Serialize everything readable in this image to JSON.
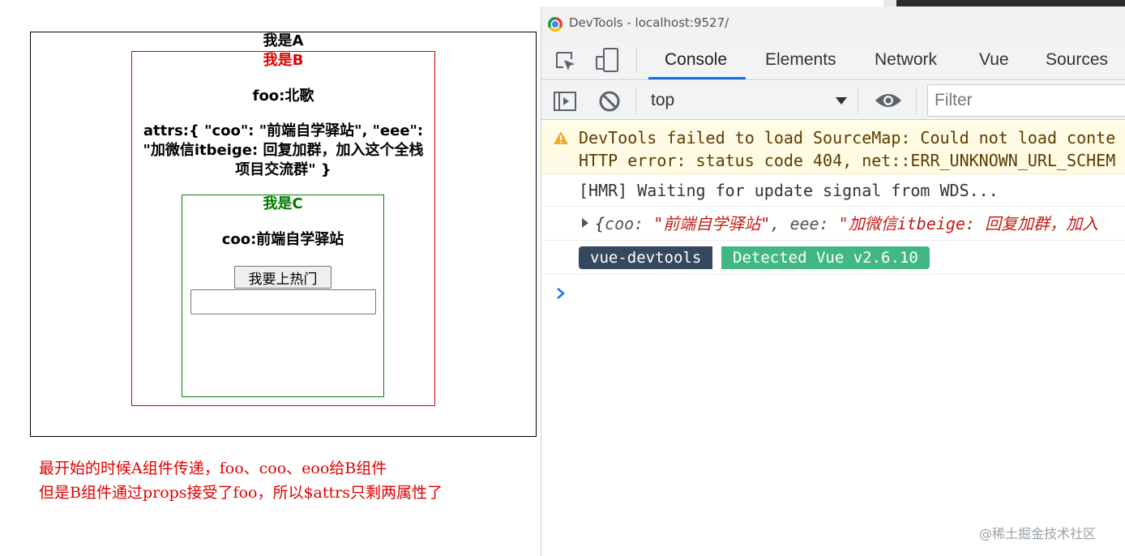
{
  "demo": {
    "title_a": "我是A",
    "title_b": "我是B",
    "foo_line": "foo:北歌",
    "attrs_line": "attrs:{ \"coo\": \"前端自学驿站\", \"eee\": \"加微信itbeige: 回复加群，加入这个全栈项目交流群\" }",
    "title_c": "我是C",
    "coo_line": "coo:前端自学驿站",
    "hot_button_label": "我要上热门",
    "input_value": ""
  },
  "notes": [
    "最开始的时候A组件传递，foo、coo、eoo给B组件",
    "但是B组件通过props接受了foo，所以$attrs只剩两属性了"
  ],
  "devtools": {
    "window_title": "DevTools - localhost:9527/",
    "tabs": [
      "Console",
      "Elements",
      "Network",
      "Vue",
      "Sources"
    ],
    "active_tab": "Console",
    "context": "top",
    "filter_placeholder": "Filter",
    "console": {
      "warning_line_1": "DevTools failed to load SourceMap: Could not load conte",
      "warning_line_2": "HTTP error: status code 404, net::ERR_UNKNOWN_URL_SCHEM",
      "hmr_message": "[HMR] Waiting for update signal from WDS...",
      "object_preview": {
        "open": "{",
        "key1": "coo",
        "sep": ": ",
        "value1": "\"前端自学驿站\"",
        "comma": ", ",
        "key2": "eee",
        "value2": "\"加微信itbeige: 回复加群，加入"
      },
      "vue_badge_left": "vue-devtools",
      "vue_badge_right": "Detected Vue v2.6.10"
    }
  },
  "watermark": "@稀土掘金技术社区",
  "colors": {
    "accent": "#1a73e8",
    "warning_bg": "#fffbe5",
    "vue_dark": "#35495e",
    "vue_green": "#41b883",
    "box_b_border": "#d40000",
    "box_c_border": "#0a7d0a",
    "note_text": "#e00000"
  }
}
